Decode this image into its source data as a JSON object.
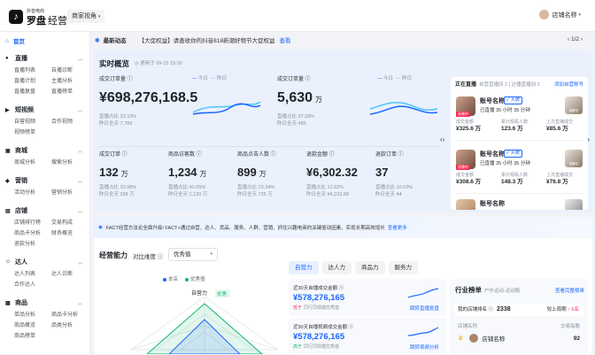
{
  "topbar": {
    "logo_mark": "♪",
    "logo_small": "抖音电商",
    "logo_main": "罗盘",
    "logo_sub": "经营",
    "seller_view": "商家视角",
    "seller_caret": "▾",
    "shop_name": "店铺名称",
    "shop_caret": "▾"
  },
  "sidebar": {
    "home_icon": "⌂",
    "home": "首页",
    "groups": [
      {
        "title": "直播",
        "icon": "●",
        "items": [
          "直播列表",
          "自播诊断",
          "直播计划",
          "主播分析",
          "直播复盘",
          "直播榜单"
        ]
      },
      {
        "title": "短视频",
        "icon": "▶",
        "items": [
          "自营视频",
          "合作视频",
          "视频榜单"
        ]
      },
      {
        "title": "商城",
        "icon": "▣",
        "items": [
          "商城分析",
          "搜索分析"
        ]
      },
      {
        "title": "营销",
        "icon": "◆",
        "items": [
          "活动分析",
          "营销分析"
        ]
      },
      {
        "title": "店铺",
        "icon": "▤",
        "items": [
          "店铺排行榜",
          "交易构成",
          "商品卡分析",
          "财务概览",
          "退款分析"
        ]
      },
      {
        "title": "达人",
        "icon": "☺",
        "items": [
          "达人列表",
          "达人诊断",
          "合作达人"
        ]
      },
      {
        "title": "商品",
        "icon": "▦",
        "items": [
          "单品分析",
          "商品卡分析",
          "商品概览",
          "品类分析",
          "商品榜单"
        ]
      }
    ]
  },
  "notice": {
    "icon": "◉",
    "label": "最新动态",
    "text": "【大促权益】请查收你的抖音818新潮好物节大促权益",
    "link": "查看",
    "pager": "‹ 1/2 ›"
  },
  "realtime": {
    "title": "实时概览",
    "update_time": "◷ 更新于 09-15 15:00",
    "metrics": [
      {
        "label": "成交订单量 ⓘ",
        "value": "¥698,276,168.5",
        "unit": "",
        "sub1": "直播占比 33.33%",
        "sub2": "昨日全天 7,789"
      },
      {
        "label": "成交订单量 ⓘ",
        "value": "5,630",
        "unit": "万",
        "sub1": "直播占比 37.28%",
        "sub2": "昨日全天 485"
      },
      {
        "label": "成交订单 ⓘ",
        "value": "132",
        "unit": "万",
        "sub1": "直播占比 33.98%",
        "sub2": "昨日全天 399 万"
      },
      {
        "label": "商品访客数 ⓘ",
        "value": "1,234",
        "unit": "万",
        "sub1": "直播占比 40.05%",
        "sub2": "昨日全天 1,139 万"
      },
      {
        "label": "商品点击人数 ⓘ",
        "value": "899",
        "unit": "万",
        "sub1": "直播占比 23.34%",
        "sub2": "昨日全天 725 万"
      },
      {
        "label": "退款金额 ⓘ",
        "value": "¥6,302.32",
        "unit": "",
        "sub1": "直播占比 12.92%",
        "sub2": "昨日全天 ¥4,223.88"
      },
      {
        "label": "退款订单 ⓘ",
        "value": "37",
        "unit": "",
        "sub1": "直播占比 10.03%",
        "sub2": "昨日全天 44"
      }
    ],
    "legend_today": "今日",
    "legend_yesterday": "昨日",
    "colors": {
      "today": "#1966ff",
      "yesterday": "#4cc3ff"
    }
  },
  "live": {
    "title": "正在直播",
    "sub": "自营直播间 2 | 达播直播间 2",
    "add_link": "添加自营账号",
    "rooms": [
      {
        "tag": "直播中",
        "name": "账号名称",
        "badge": "✓ 大牌",
        "info": "已直播 35 小时 35 分钟",
        "thumb": "讲解中",
        "stats": [
          [
            "成交金额",
            "¥325.6 万"
          ],
          [
            "累计观看人数",
            "123.6 万"
          ],
          [
            "上次直播成交",
            "¥85.6 万"
          ]
        ]
      },
      {
        "tag": "直播中",
        "name": "账号名称",
        "badge": "✓ 大牌",
        "info": "已直播 35 小时 35 分钟",
        "thumb": "讲解中",
        "stats": [
          [
            "成交金额",
            "¥308.6 万"
          ],
          [
            "累计观看人数",
            "148.3 万"
          ],
          [
            "上次直播成交",
            "¥76.8 万"
          ]
        ]
      }
    ],
    "more_name": "账号名称",
    "left_arrow": "‹›",
    "right_arrow": "›"
  },
  "fact": {
    "icon": "◉",
    "text": "FACT经营方法论全面升级! FACT+通过自营、达人、货品、服务、人群、营销、抓住兴趣电商的关键驱动因素，实现长期高效增长",
    "link": "查看更多"
  },
  "ability": {
    "title": "经营能力",
    "dim_label": "对比维度 ⓘ",
    "dim_value": "优秀值",
    "dim_caret": "▾",
    "legend": [
      {
        "name": "本店",
        "color": "#1966ff"
      },
      {
        "name": "优秀值",
        "color": "#0fb86e"
      }
    ],
    "radar_labels": [
      "自营力",
      "优秀"
    ],
    "tabs": [
      "自营力",
      "达人力",
      "商品力",
      "服务力"
    ],
    "cards": [
      {
        "title": "近30天自播成交金额 ⓘ",
        "value": "¥578,276,165",
        "note_tag": "低于",
        "note": "同行同规模优秀值",
        "link": "跳转直播复盘",
        "tag_color": "red"
      },
      {
        "title": "近30天自播视频成交金额 ⓘ",
        "value": "¥578,276,165",
        "note_tag": "高于",
        "note": "同行同规模优秀值",
        "link": "跳转视频分析",
        "tag_color": "green"
      }
    ]
  },
  "rank": {
    "title": "行业榜单",
    "sub": "户外运动-运动鞋",
    "link": "查看完整榜单",
    "my_label": "我的店铺排名 ⓘ",
    "my_value": "2338",
    "up_label": "较上周期",
    "up_value": "↑ 6名",
    "col_left": "店铺名称",
    "col_right": "交易指数",
    "rows": [
      {
        "rank_icon": "♛",
        "name": "店铺名称",
        "index": "92"
      }
    ]
  }
}
